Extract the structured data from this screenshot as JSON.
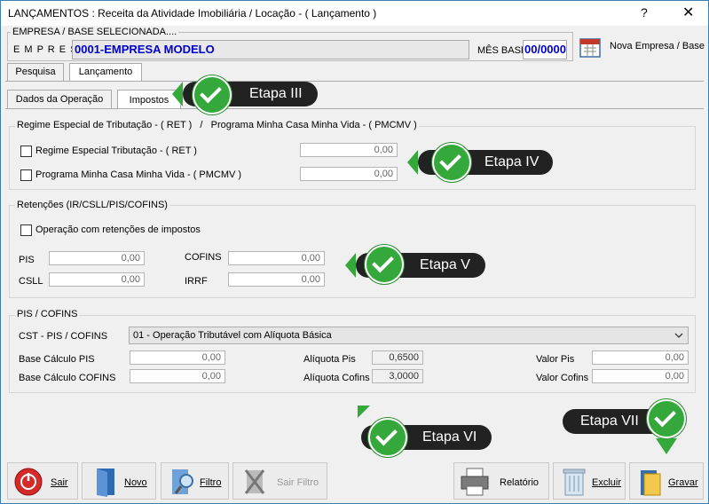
{
  "window": {
    "title": "LANÇAMENTOS : Receita da Atividade Imobiliária / Locação - ( Lançamento )",
    "help_glyph": "?",
    "close_glyph": "✕"
  },
  "company": {
    "group_label": "EMPRESA  /  BASE  SELECIONADA....",
    "empresa_label": "E M P R E S A",
    "empresa_value": "0001-EMPRESA MODELO",
    "mes_base_label": "MÊS BASE",
    "mes_base_value": "00/0000",
    "nova_empresa_label": "Nova Empresa / Base"
  },
  "main_tabs": [
    "Pesquisa",
    "Lançamento"
  ],
  "sub_tabs": [
    "Dados da Operação",
    "Impostos"
  ],
  "ret_section": {
    "title": "Regime Especial de Tributação - ( RET )   /   Programa Minha Casa Minha Vida - ( PMCMV )",
    "rows": [
      {
        "label": "Regime Especial Tributação - ( RET )",
        "value": "0,00"
      },
      {
        "label": "Programa Minha Casa Minha Vida - ( PMCMV )",
        "value": "0,00"
      }
    ]
  },
  "retencoes": {
    "title": "Retenções (IR/CSLL/PIS/COFINS)",
    "checkbox_label": "Operação com retenções de impostos",
    "pis_label": "PIS",
    "pis_value": "0,00",
    "csll_label": "CSLL",
    "csll_value": "0,00",
    "cofins_label": "COFINS",
    "cofins_value": "0,00",
    "irrf_label": "IRRF",
    "irrf_value": "0,00"
  },
  "pis_cofins": {
    "title": "PIS / COFINS",
    "cst_label": "CST - PIS / COFINS",
    "cst_value": "01 - Operação Tributável com Alíquota Básica",
    "base_pis_label": "Base Cálculo PIS",
    "base_pis_value": "0,00",
    "base_cofins_label": "Base Cálculo COFINS",
    "base_cofins_value": "0,00",
    "aliq_pis_label": "Alíquota Pis",
    "aliq_pis_value": "0,6500",
    "aliq_cofins_label": "Alíquota Cofins",
    "aliq_cofins_value": "3,0000",
    "valor_pis_label": "Valor Pis",
    "valor_pis_value": "0,00",
    "valor_cofins_label": "Valor Cofins",
    "valor_cofins_value": "0,00"
  },
  "buttons": {
    "sair": "Sair",
    "novo": "Novo",
    "filtro": "Filtro",
    "sair_filtro": "Sair Filtro",
    "relatorio": "Relatório",
    "excluir": "Excluir",
    "gravar": "Gravar"
  },
  "callouts": {
    "etapa3": "Etapa III",
    "etapa4": "Etapa IV",
    "etapa5": "Etapa V",
    "etapa6": "Etapa VI",
    "etapa7": "Etapa VII"
  },
  "colors": {
    "accent_blue": "#0000cc",
    "callout_bg": "#222222",
    "check_green": "#34a83a"
  }
}
